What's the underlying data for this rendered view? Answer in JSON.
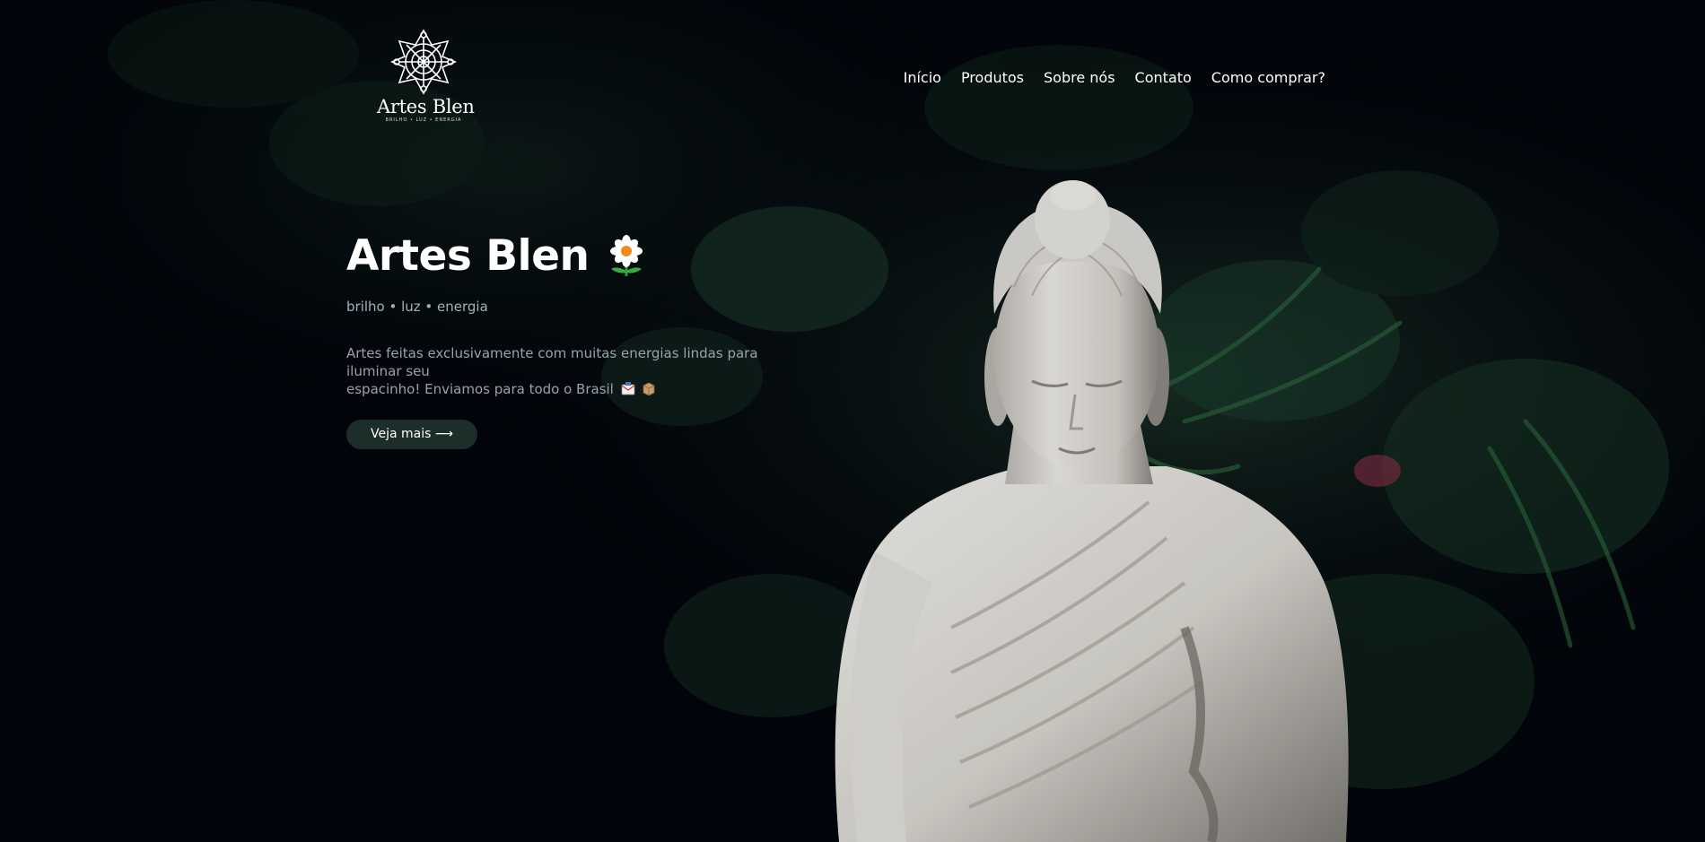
{
  "brand": {
    "logo_name": "Artes Blen",
    "logo_tagline": "BRILHO • LUZ • ENERGIA"
  },
  "nav": {
    "items": [
      {
        "label": "Início"
      },
      {
        "label": "Produtos"
      },
      {
        "label": "Sobre nós"
      },
      {
        "label": "Contato"
      },
      {
        "label": "Como comprar?"
      }
    ]
  },
  "hero": {
    "title": "Artes Blen",
    "title_icon": "daisy-flower-icon",
    "tagline": "brilho • luz • energia",
    "description_line1": "Artes feitas exclusivamente com muitas energias lindas para iluminar seu",
    "description_line2": "espacinho! Enviamos para todo o Brasil",
    "description_icons": [
      "envelope-icon",
      "package-icon"
    ],
    "cta_label": "Veja mais ⟶"
  },
  "background": {
    "subject": "buddha-statue-image",
    "colors": {
      "base": "#02050a",
      "foliage": "#1f3a2c",
      "statue": "#e9e7e2"
    }
  }
}
